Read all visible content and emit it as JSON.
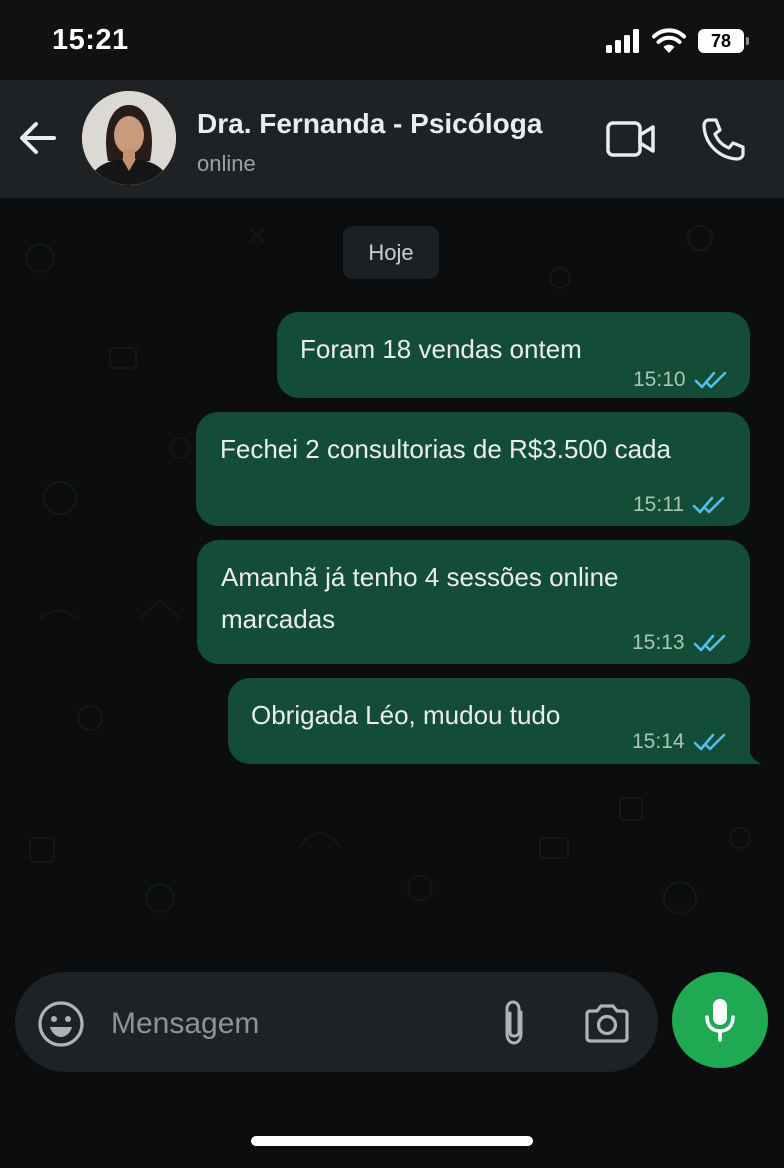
{
  "status_bar": {
    "time": "15:21",
    "battery": "78",
    "icons": [
      "signal-icon",
      "wifi-icon",
      "battery-icon"
    ]
  },
  "header": {
    "contact_name": "Dra. Fernanda - Psicóloga",
    "status": "online",
    "icons": [
      "back-arrow-icon",
      "video-call-icon",
      "phone-icon"
    ]
  },
  "chat": {
    "date_chip": "Hoje",
    "messages": [
      {
        "text": "Foram 18 vendas ontem",
        "time": "15:10",
        "status": "read"
      },
      {
        "text": "Fechei 2 consultorias de R$3.500 cada",
        "time": "15:11",
        "status": "read"
      },
      {
        "text": "Amanhã já tenho 4 sessões online\nmarcadas",
        "time": "15:13",
        "status": "read"
      },
      {
        "text": "Obrigada Léo, mudou tudo",
        "time": "15:14",
        "status": "read"
      }
    ]
  },
  "composer": {
    "placeholder": "Mensagem",
    "icons": [
      "emoji-icon",
      "attach-icon",
      "camera-icon",
      "mic-icon"
    ]
  },
  "colors": {
    "outgoing_bubble": "#144d37",
    "read_ticks": "#53bdeb",
    "mic_button": "#1ea952",
    "header_bg": "#1f2225"
  }
}
